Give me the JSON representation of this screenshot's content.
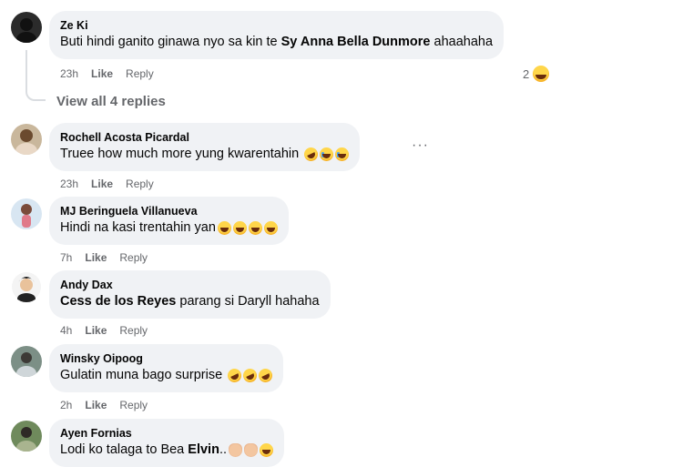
{
  "view_all_replies": "View all 4 replies",
  "reaction_count": "2",
  "comments": [
    {
      "author": "Ze Ki",
      "text_before": "Buti hindi ganito ginawa nyo sa kin te ",
      "mention": "Sy Anna Bella Dunmore",
      "text_after": " ahaahaha",
      "time": "23h",
      "like": "Like",
      "reply": "Reply"
    },
    {
      "author": "Rochell Acosta Picardal",
      "text": "Truee how much more yung kwarentahin ",
      "emojis": [
        "rolling-on-floor-laughing",
        "crying-face",
        "crying-face"
      ],
      "time": "23h",
      "like": "Like",
      "reply": "Reply"
    },
    {
      "author": "MJ Beringuela Villanueva",
      "text": "Hindi na kasi trentahin yan",
      "emojis": [
        "laughing",
        "laughing",
        "laughing",
        "laughing"
      ],
      "time": "7h",
      "like": "Like",
      "reply": "Reply"
    },
    {
      "author": "Andy Dax",
      "mention": "Cess de los Reyes",
      "text_after": " parang si Daryll hahaha",
      "time": "4h",
      "like": "Like",
      "reply": "Reply"
    },
    {
      "author": "Winsky Oipoog",
      "text": "Gulatin muna bago surprise ",
      "emojis": [
        "rolling-on-floor-laughing",
        "rolling-on-floor-laughing",
        "rolling-on-floor-laughing"
      ],
      "time": "2h",
      "like": "Like",
      "reply": "Reply"
    },
    {
      "author": "Ayen Fornias",
      "text_before": "Lodi ko talaga to Bea ",
      "mention": "Elvin",
      "text_after": "..",
      "emojis": [
        "clapping-hands",
        "clapping-hands",
        "laughing"
      ],
      "time": "",
      "like": "",
      "reply": ""
    }
  ],
  "colors": {
    "bubble": "#f0f2f5",
    "meta_text": "#65676b",
    "text": "#050505"
  }
}
